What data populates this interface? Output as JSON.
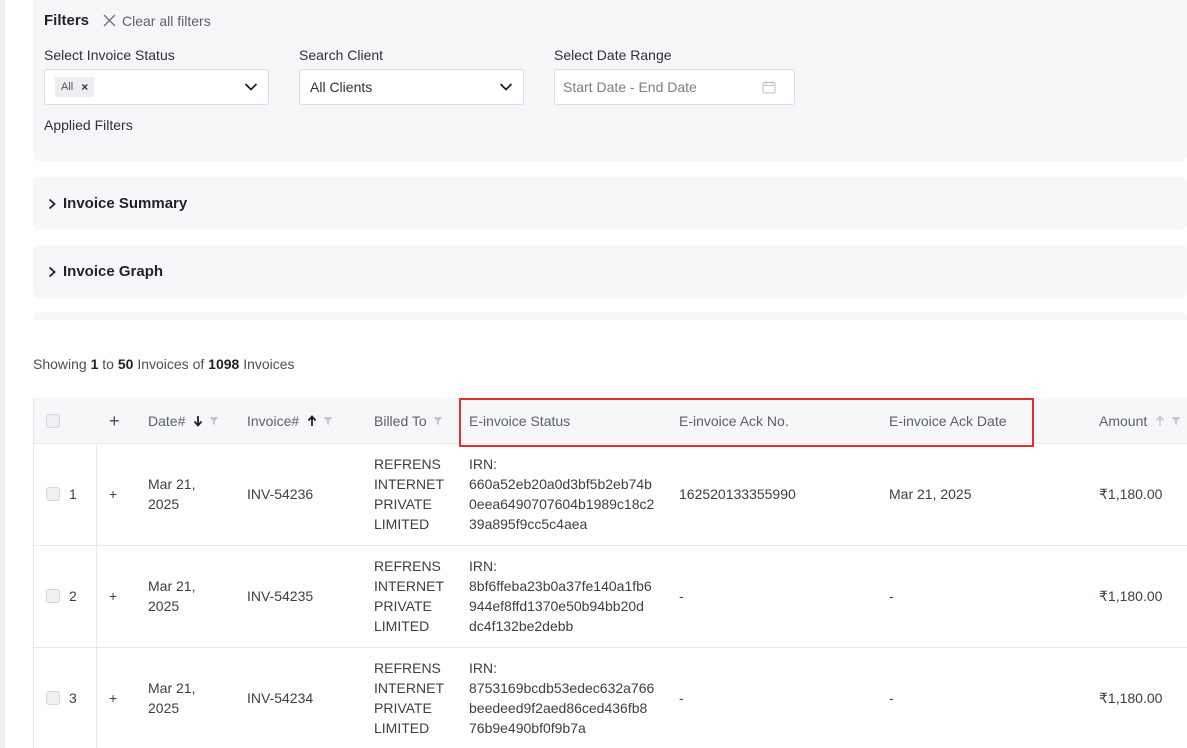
{
  "filters": {
    "title": "Filters",
    "clear_label": "Clear all filters",
    "status_label": "Select Invoice Status",
    "status_tag": "All",
    "status_tag_remove": "×",
    "client_label": "Search Client",
    "client_value": "All Clients",
    "date_label": "Select Date Range",
    "date_placeholder": "Start Date - End Date",
    "applied_label": "Applied Filters"
  },
  "sections": {
    "summary_label": "Invoice Summary",
    "graph_label": "Invoice Graph"
  },
  "showing": {
    "prefix": "Showing",
    "from": "1",
    "to_word": "to",
    "to": "50",
    "middle": "Invoices of",
    "total": "1098",
    "suffix": "Invoices"
  },
  "table": {
    "columns": {
      "expand": "+",
      "date": "Date#",
      "invoice": "Invoice#",
      "billed_to": "Billed To",
      "einvoice_status": "E-invoice Status",
      "ack_no": "E-invoice Ack No.",
      "ack_date": "E-invoice Ack Date",
      "amount": "Amount"
    },
    "rows": [
      {
        "index": "1",
        "expand": "+",
        "date_line1": "Mar 21,",
        "date_line2": "2025",
        "invoice": "INV-54236",
        "billed1": "REFRENS",
        "billed2": "INTERNET",
        "billed3": "PRIVATE",
        "billed4": "LIMITED",
        "irn_label": "IRN:",
        "irn1": "660a52eb20a0d3bf5b2eb74b",
        "irn2": "0eea6490707604b1989c18c2",
        "irn3": "39a895f9cc5c4aea",
        "ack_no": "162520133355990",
        "ack_date": "Mar 21, 2025",
        "amount": "₹1,180.00"
      },
      {
        "index": "2",
        "expand": "+",
        "date_line1": "Mar 21,",
        "date_line2": "2025",
        "invoice": "INV-54235",
        "billed1": "REFRENS",
        "billed2": "INTERNET",
        "billed3": "PRIVATE",
        "billed4": "LIMITED",
        "irn_label": "IRN:",
        "irn1": "8bf6ffeba23b0a37fe140a1fb6",
        "irn2": "944ef8ffd1370e50b94bb20d",
        "irn3": "dc4f132be2debb",
        "ack_no": "-",
        "ack_date": "-",
        "amount": "₹1,180.00"
      },
      {
        "index": "3",
        "expand": "+",
        "date_line1": "Mar 21,",
        "date_line2": "2025",
        "invoice": "INV-54234",
        "billed1": "REFRENS",
        "billed2": "INTERNET",
        "billed3": "PRIVATE",
        "billed4": "LIMITED",
        "irn_label": "IRN:",
        "irn1": "8753169bcdb53edec632a766",
        "irn2": "beedeed9f2aed86ced436fb8",
        "irn3": "76b9e490bf0f9b7a",
        "ack_no": "-",
        "ack_date": "-",
        "amount": "₹1,180.00"
      }
    ]
  },
  "colors": {
    "highlight": "#e03131",
    "panel_bg": "#f6f7f9"
  }
}
